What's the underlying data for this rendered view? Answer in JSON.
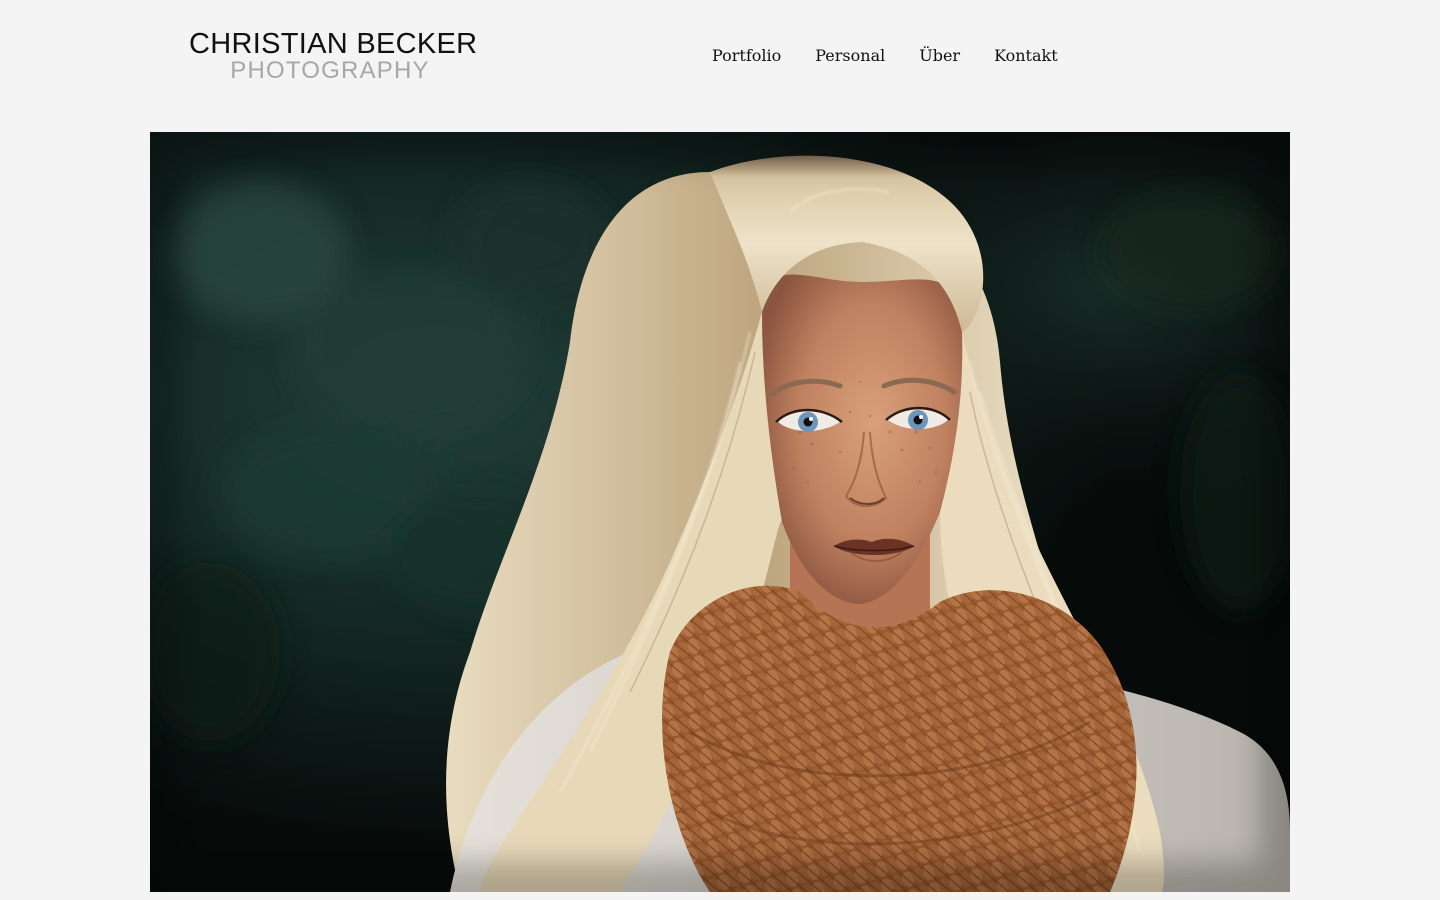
{
  "header": {
    "logo": {
      "name_line": "CHRISTIAN BECKER",
      "tagline": "PHOTOGRAPHY"
    },
    "nav": [
      {
        "label": "Portfolio"
      },
      {
        "label": "Personal"
      },
      {
        "label": "Über"
      },
      {
        "label": "Kontakt"
      }
    ]
  },
  "hero": {
    "subject": "portrait-photo",
    "colors": {
      "background_dark": "#070b0a",
      "foliage": "#1d3530",
      "hair": "#e9dcc0",
      "skin": "#c9906c",
      "scarf": "#9a5a2e",
      "sweater": "#d8d4cf"
    }
  }
}
